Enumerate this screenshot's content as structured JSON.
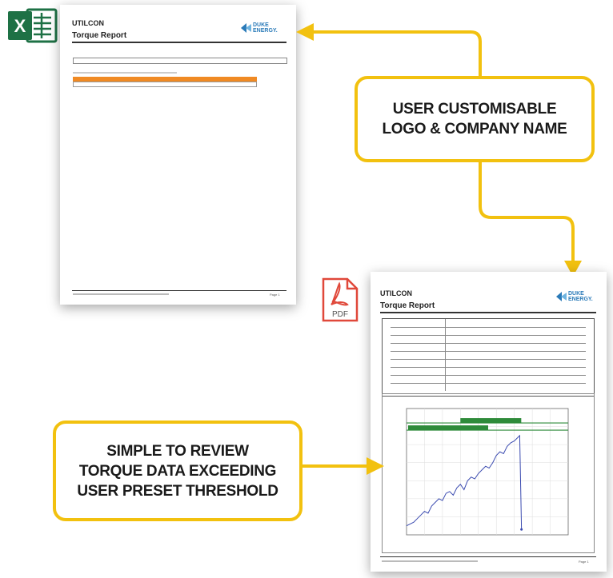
{
  "colors": {
    "accent": "#f2c10f",
    "excel_green": "#1e7145",
    "pdf_red": "#e0483a",
    "logo_blue": "#2a7ab8",
    "table_header": "#f08a24",
    "threshold_green": "#2e8b3a",
    "series_blue": "#3b4bb0"
  },
  "icons": {
    "excel": "excel-icon",
    "pdf": "pdf-icon"
  },
  "excel_icon": {
    "letter": "X"
  },
  "pdf_icon": {
    "label": "PDF"
  },
  "report": {
    "company": "UTILCON",
    "title": "Torque Report",
    "logo_line1": "DUKE",
    "logo_line2": "ENERGY.",
    "page_label": "Page 1"
  },
  "callouts": {
    "logo": [
      "USER CUSTOMISABLE",
      "LOGO & COMPANY NAME"
    ],
    "torque": [
      "SIMPLE TO REVIEW",
      "TORQUE DATA EXCEEDING",
      "USER PRESET THRESHOLD"
    ]
  },
  "chart_data": {
    "type": "line",
    "title": "",
    "xlabel": "",
    "ylabel": "",
    "x": [
      0,
      2,
      4,
      6,
      8,
      10,
      12,
      14,
      16,
      18,
      20,
      22,
      24,
      26,
      28,
      30,
      32,
      34,
      36,
      38,
      40,
      42,
      44,
      46,
      48,
      50,
      52,
      54,
      56,
      58,
      60,
      62,
      63,
      64
    ],
    "series": [
      {
        "values": [
          5,
          6,
          7,
          9,
          11,
          13,
          12,
          16,
          18,
          20,
          19,
          23,
          24,
          22,
          26,
          28,
          25,
          30,
          32,
          31,
          34,
          36,
          38,
          37,
          40,
          44,
          46,
          45,
          49,
          51,
          52,
          54,
          55,
          3
        ]
      }
    ],
    "thresholds": [
      58,
      62
    ],
    "ylim": [
      0,
      70
    ],
    "xlim": [
      0,
      90
    ],
    "grid": true
  }
}
